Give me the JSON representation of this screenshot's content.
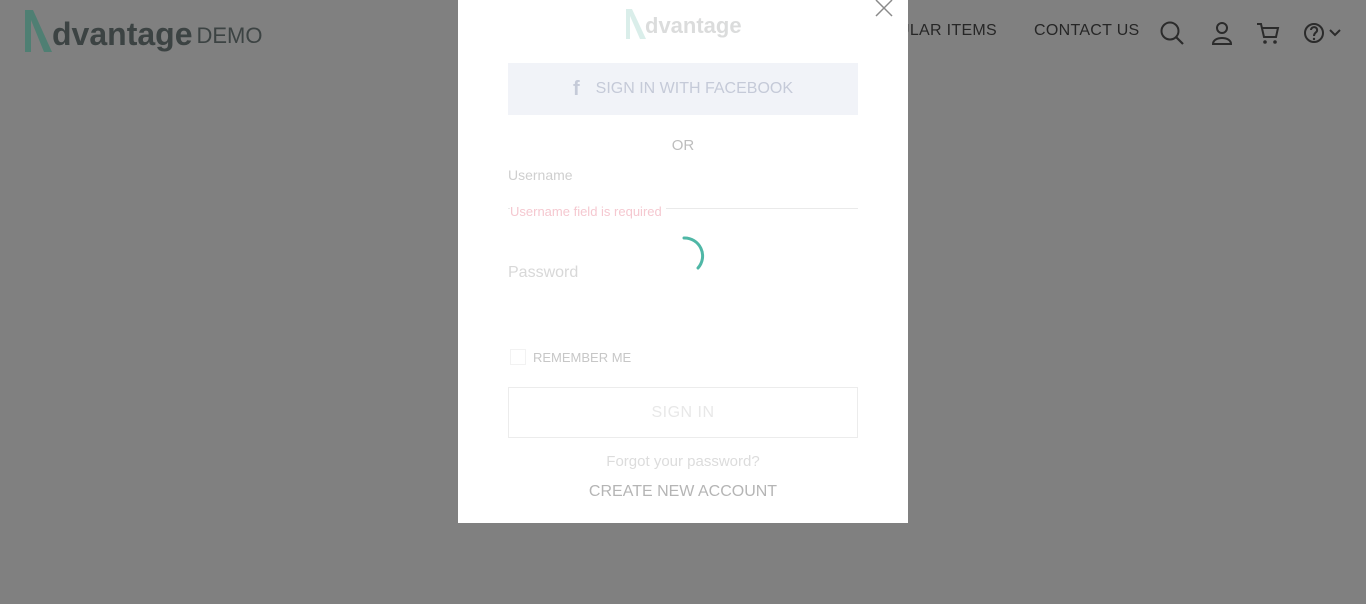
{
  "header": {
    "logo_text": "dvantage",
    "logo_demo": "DEMO",
    "nav_popular": "ULAR ITEMS",
    "nav_contact": "CONTACT US",
    "icons": [
      "search-icon",
      "user-icon",
      "cart-icon",
      "help-icon",
      "chevron-down-icon"
    ]
  },
  "modal": {
    "logo_text": "dvantage",
    "facebook_label": "SIGN IN WITH FACEBOOK",
    "or_label": "OR",
    "username_label": "Username",
    "username_error": "Username field is required",
    "password_label": "Password",
    "remember_label": "REMEMBER ME",
    "signin_label": "SIGN IN",
    "forgot_label": "Forgot your password?",
    "create_label": "CREATE NEW ACCOUNT"
  },
  "colors": {
    "overlay": "#808080",
    "accent": "#4fb7a6",
    "brand_text": "#3c4343"
  }
}
